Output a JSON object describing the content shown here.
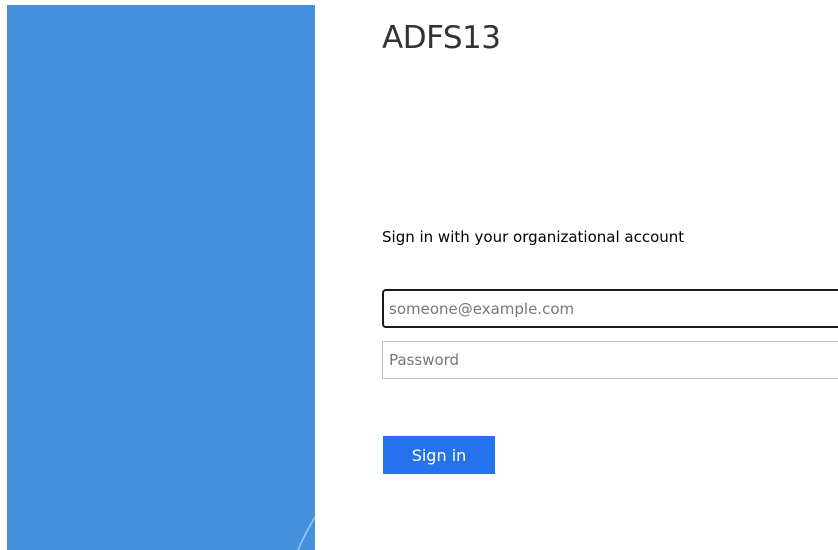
{
  "page": {
    "title": "ADFS13",
    "intro_text": "Sign in with your organizational account"
  },
  "form": {
    "username": {
      "value": "",
      "placeholder": "someone@example.com"
    },
    "password": {
      "value": "",
      "placeholder": "Password"
    },
    "submit_label": "Sign in"
  },
  "colors": {
    "illustration_background": "#4490dd",
    "submit_button_background": "#2672ec",
    "submit_button_text": "#ffffff",
    "active_field_border": "#1a1a1a",
    "field_border": "#c2c2c2",
    "title_text": "#333333"
  }
}
